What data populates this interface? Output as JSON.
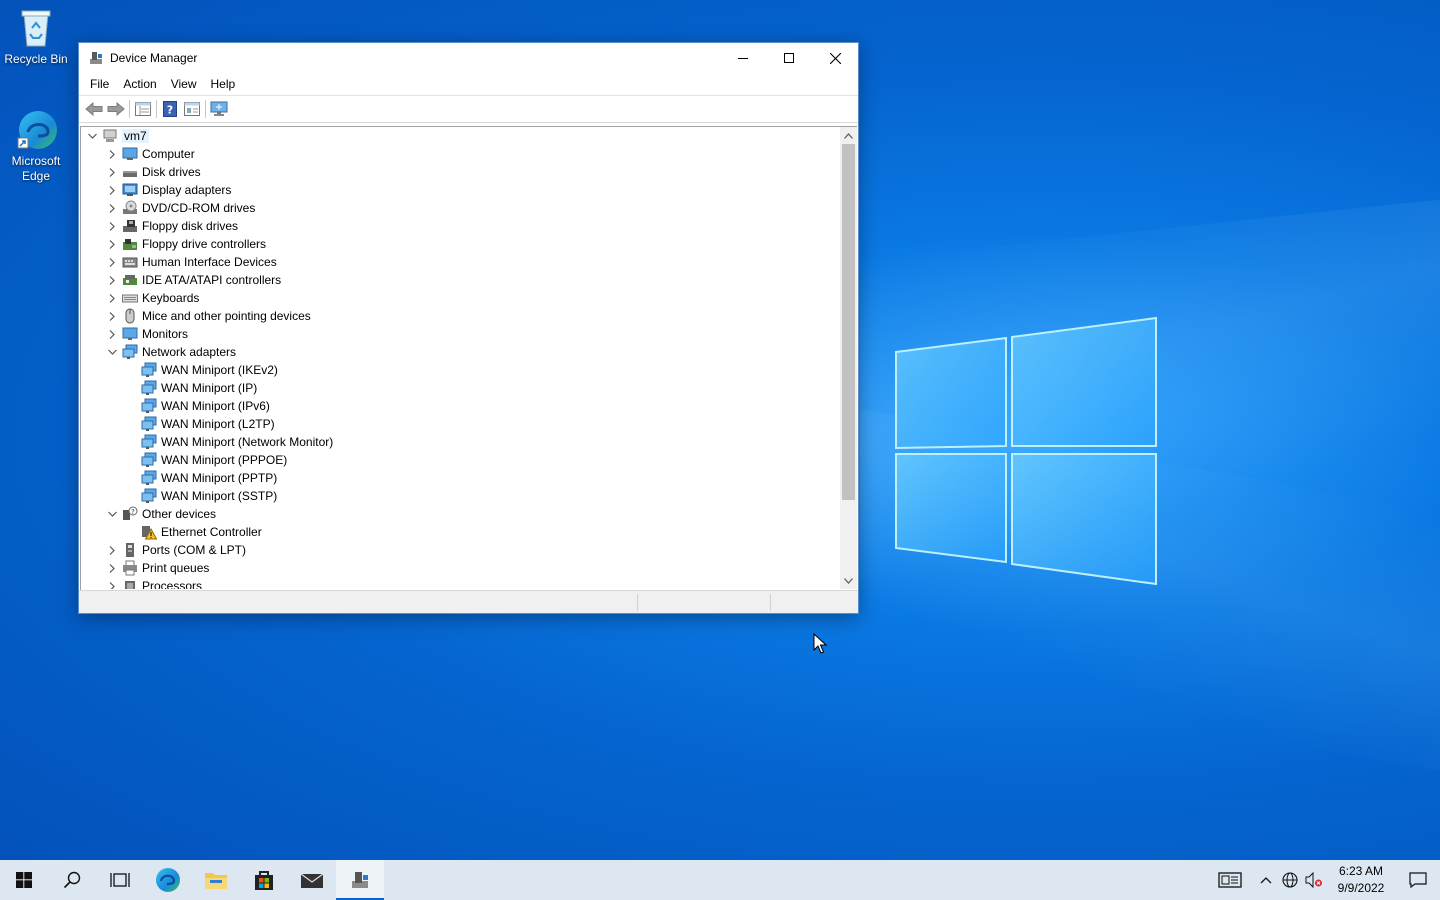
{
  "desktop": {
    "icons": [
      {
        "label": "Recycle Bin",
        "icon": "recycle-bin-icon"
      },
      {
        "label": "Microsoft Edge",
        "icon": "edge-icon"
      }
    ]
  },
  "window": {
    "title": "Device Manager",
    "controls": {
      "minimize": "minimize-icon",
      "maximize": "maximize-icon",
      "close": "close-icon"
    }
  },
  "menu": [
    "File",
    "Action",
    "View",
    "Help"
  ],
  "toolbar": [
    "back-icon",
    "forward-icon",
    "properties-icon",
    "help-icon",
    "details-icon",
    "scan-monitor-icon"
  ],
  "tree": {
    "root": "vm7",
    "categories": [
      {
        "label": "Computer",
        "icon": "computer-icon",
        "expanded": false
      },
      {
        "label": "Disk drives",
        "icon": "disk-icon",
        "expanded": false
      },
      {
        "label": "Display adapters",
        "icon": "display-adapter-icon",
        "expanded": false
      },
      {
        "label": "DVD/CD-ROM drives",
        "icon": "dvd-icon",
        "expanded": false
      },
      {
        "label": "Floppy disk drives",
        "icon": "floppy-icon",
        "expanded": false
      },
      {
        "label": "Floppy drive controllers",
        "icon": "floppy-controller-icon",
        "expanded": false
      },
      {
        "label": "Human Interface Devices",
        "icon": "hid-icon",
        "expanded": false
      },
      {
        "label": "IDE ATA/ATAPI controllers",
        "icon": "ide-icon",
        "expanded": false
      },
      {
        "label": "Keyboards",
        "icon": "keyboard-icon",
        "expanded": false
      },
      {
        "label": "Mice and other pointing devices",
        "icon": "mouse-icon",
        "expanded": false
      },
      {
        "label": "Monitors",
        "icon": "monitor-icon",
        "expanded": false
      },
      {
        "label": "Network adapters",
        "icon": "network-icon",
        "expanded": true,
        "children": [
          "WAN Miniport (IKEv2)",
          "WAN Miniport (IP)",
          "WAN Miniport (IPv6)",
          "WAN Miniport (L2TP)",
          "WAN Miniport (Network Monitor)",
          "WAN Miniport (PPPOE)",
          "WAN Miniport (PPTP)",
          "WAN Miniport (SSTP)"
        ]
      },
      {
        "label": "Other devices",
        "icon": "unknown-device-icon",
        "expanded": true,
        "children": [
          "Ethernet Controller"
        ]
      },
      {
        "label": "Ports (COM & LPT)",
        "icon": "port-icon",
        "expanded": false
      },
      {
        "label": "Print queues",
        "icon": "printer-icon",
        "expanded": false
      },
      {
        "label": "Processors",
        "icon": "processor-icon",
        "expanded": false
      }
    ]
  },
  "taskbar": {
    "items": [
      "start-icon",
      "search-icon",
      "task-view-icon",
      "edge-icon",
      "file-explorer-icon",
      "store-icon",
      "mail-icon",
      "device-manager-icon"
    ],
    "clock": {
      "time": "6:23 AM",
      "date": "9/9/2022"
    }
  },
  "colors": {
    "accent": "#0a63c9",
    "selection": "#e5f1fb"
  }
}
